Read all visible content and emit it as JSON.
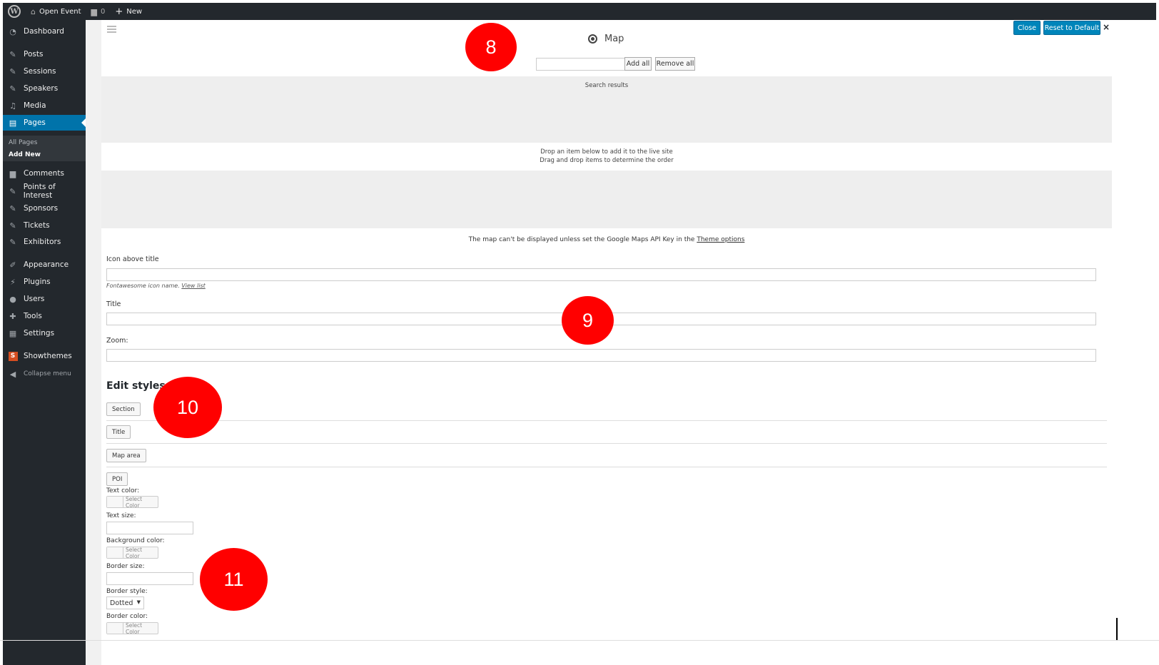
{
  "admin_bar": {
    "site_name": "Open Event",
    "comments_count": "0",
    "new_label": "New"
  },
  "sidebar": {
    "items": [
      {
        "label": "Dashboard",
        "icon": "dashboard-icon"
      },
      {
        "label": "Posts",
        "icon": "pin-icon"
      },
      {
        "label": "Sessions",
        "icon": "pin-icon"
      },
      {
        "label": "Speakers",
        "icon": "pin-icon"
      },
      {
        "label": "Media",
        "icon": "media-icon"
      },
      {
        "label": "Pages",
        "icon": "pages-icon"
      },
      {
        "label": "Comments",
        "icon": "comment-icon"
      },
      {
        "label": "Points of Interest",
        "icon": "pin-icon"
      },
      {
        "label": "Sponsors",
        "icon": "pin-icon"
      },
      {
        "label": "Tickets",
        "icon": "pin-icon"
      },
      {
        "label": "Exhibitors",
        "icon": "pin-icon"
      },
      {
        "label": "Appearance",
        "icon": "brush-icon"
      },
      {
        "label": "Plugins",
        "icon": "plug-icon"
      },
      {
        "label": "Users",
        "icon": "user-icon"
      },
      {
        "label": "Tools",
        "icon": "wrench-icon"
      },
      {
        "label": "Settings",
        "icon": "settings-icon"
      },
      {
        "label": "Showthemes",
        "icon": "showthemes-icon"
      }
    ],
    "submenu": {
      "all_pages": "All Pages",
      "add_new": "Add New"
    },
    "collapse": "Collapse menu"
  },
  "header": {
    "close_label": "Close",
    "reset_label": "Reset to Default",
    "dismiss": "×"
  },
  "widget": {
    "title": "Map",
    "search_placeholder": "",
    "add_all": "Add all",
    "remove_all": "Remove all",
    "search_results": "Search results",
    "drop_line1": "Drop an item below to add it to the live site",
    "drop_line2": "Drag and drop items to determine the order",
    "notice": "The map can't be displayed unless set the Google Maps API Key in the ",
    "notice_link": "Theme options"
  },
  "fields": {
    "icon_label": "Icon above title",
    "icon_help": "Fontawesome icon name. ",
    "icon_help_link": "View list",
    "title_label": "Title",
    "zoom_label": "Zoom:"
  },
  "styles": {
    "heading": "Edit styles",
    "section_btn": "Section",
    "title_btn": "Title",
    "map_area_btn": "Map area",
    "poi_btn": "POI",
    "text_color": "Text color:",
    "text_size": "Text size:",
    "background_color": "Background color:",
    "border_size": "Border size:",
    "border_style": "Border style:",
    "border_style_value": "Dotted",
    "border_color": "Border color:",
    "select_color": "Select Color"
  },
  "badges": [
    "8",
    "9",
    "10",
    "11"
  ],
  "colors": {
    "admin_bg": "#23282d",
    "accent": "#0073aa",
    "button_blue": "#0085ba",
    "badge_red": "#ff0000"
  }
}
